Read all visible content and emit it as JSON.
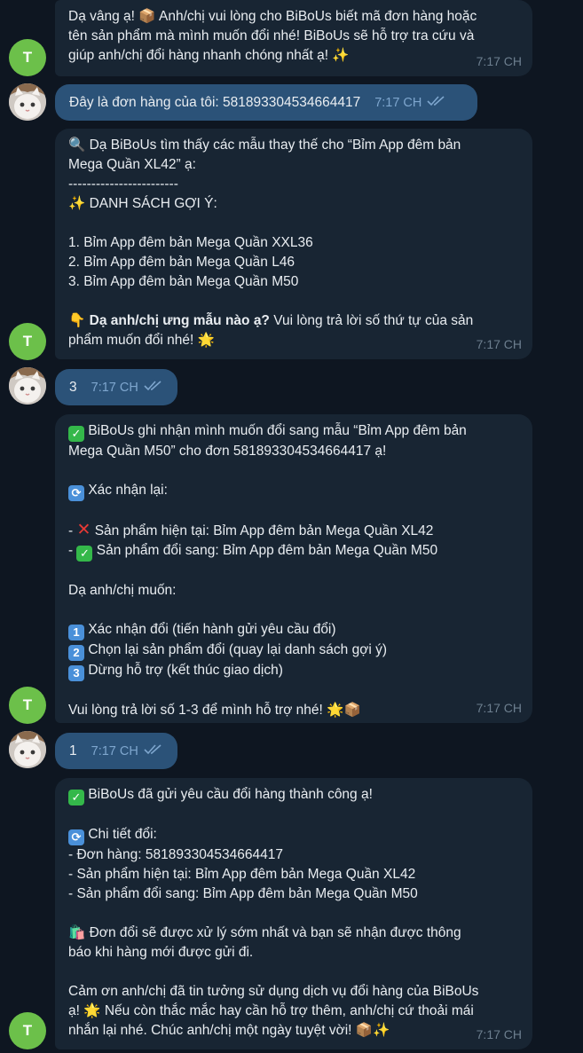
{
  "messages": {
    "m1": {
      "lines": [
        "Dạ vâng ạ! 📦 Anh/chị vui lòng cho BiBoUs biết mã đơn hàng hoặc",
        "tên sản phẩm mà mình muốn đổi nhé! BiBoUs sẽ hỗ trợ tra cứu và",
        "giúp anh/chị đổi hàng nhanh chóng nhất ạ! ✨"
      ],
      "time": "7:17 CH"
    },
    "m2": {
      "text": "Đây là đơn hàng của tôi: 581893304534664417",
      "time": "7:17 CH"
    },
    "m3": {
      "lines": [
        "🔍 Dạ BiBoUs tìm thấy các mẫu thay thế cho “Bỉm App đêm bản",
        "Mega Quần XL42” ạ:",
        "------------------------",
        "✨ DANH SÁCH GỢI Ý:",
        "",
        "1. Bỉm App đêm bản Mega Quần XXL36",
        "2. Bỉm App đêm bản Mega Quần L46",
        "3. Bỉm App đêm bản Mega Quần M50",
        ""
      ],
      "q_icon": "👇",
      "q_bold": "Dạ anh/chị ưng mẫu nào ạ?",
      "q_rest": " Vui lòng trả lời số thứ tự của sản",
      "q_line2": "phẩm muốn đổi nhé! 🌟",
      "time": "7:17 CH"
    },
    "m4": {
      "text": "3",
      "time": "7:17 CH"
    },
    "m5": {
      "l1": "BiBoUs ghi nhận mình muốn đổi sang mẫu “Bỉm App đêm bản",
      "l2": "Mega Quần M50” cho đơn 581893304534664417 ạ!",
      "l3": "Xác nhận lại:",
      "l4_prefix": "- ",
      "l4": "Sản phẩm hiện tại: Bỉm App đêm bản Mega Quần XL42",
      "l5_prefix": "- ",
      "l5": "Sản phẩm đổi sang: Bỉm App đêm bản Mega Quần M50",
      "l6": "Dạ anh/chị muốn:",
      "opt1": "Xác nhận đổi (tiến hành gửi yêu cầu đổi)",
      "opt2": "Chọn lại sản phẩm đổi (quay lại danh sách gợi ý)",
      "opt3": "Dừng hỗ trợ (kết thúc giao dịch)",
      "l7": "Vui lòng trả lời số 1-3 để mình hỗ trợ nhé! 🌟📦",
      "time": "7:17 CH"
    },
    "m6": {
      "text": "1",
      "time": "7:17 CH"
    },
    "m7": {
      "l1": "BiBoUs đã gửi yêu cầu đổi hàng thành công ạ!",
      "l2": "Chi tiết đổi:",
      "l3": "- Đơn hàng: 581893304534664417",
      "l4": "- Sản phẩm hiện tại: Bỉm App đêm bản Mega Quần XL42",
      "l5": "- Sản phẩm đổi sang: Bỉm App đêm bản Mega Quần M50",
      "l6": "🛍️ Đơn đổi sẽ được xử lý sớm nhất và bạn sẽ nhận được thông",
      "l7": "báo khi hàng mới được gửi đi.",
      "l8": "Cảm ơn anh/chị đã tin tưởng sử dụng dịch vụ đổi hàng của BiBoUs",
      "l9": "ạ! 🌟 Nếu còn thắc mắc hay cần hỗ trợ thêm, anh/chị cứ thoải mái",
      "l10": "nhắn lại nhé. Chúc anh/chị một ngày tuyệt vời! 📦✨",
      "time": "7:17 CH"
    }
  },
  "bot_avatar_letter": "T",
  "colors": {
    "background": "#0e1621",
    "incoming_bubble": "#182533",
    "outgoing_bubble": "#2b5278",
    "bot_avatar": "#6cc04a"
  }
}
